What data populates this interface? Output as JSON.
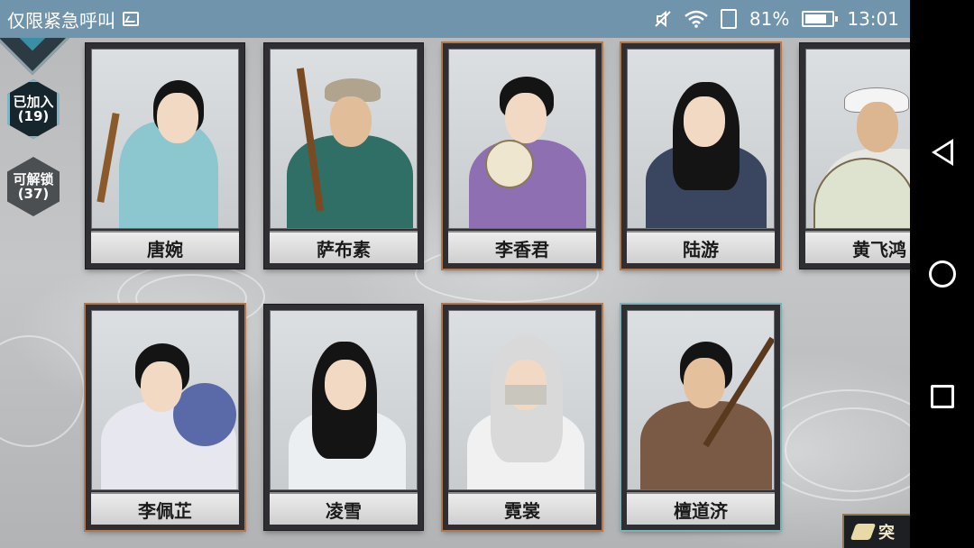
{
  "status_bar": {
    "carrier_text": "仅限紧急呼叫",
    "battery_percent_text": "81%",
    "battery_level": 0.81,
    "time": "13:01",
    "icons": [
      "image-icon",
      "mute-icon",
      "wifi-icon",
      "sim-icon",
      "battery-icon"
    ]
  },
  "side_panel": {
    "joined_label": "已加入",
    "joined_count": "(19)",
    "unlockable_label": "可解锁",
    "unlockable_count": "(37)"
  },
  "characters": [
    {
      "name": "唐婉",
      "frame": "dark"
    },
    {
      "name": "萨布素",
      "frame": "dark"
    },
    {
      "name": "李香君",
      "frame": "orange"
    },
    {
      "name": "陆游",
      "frame": "orange"
    },
    {
      "name": "黄飞鸿",
      "frame": "dark"
    },
    {
      "name": "李佩芷",
      "frame": "orange"
    },
    {
      "name": "凌雪",
      "frame": "dark"
    },
    {
      "name": "霓裳",
      "frame": "orange"
    },
    {
      "name": "檀道济",
      "frame": "teal"
    }
  ],
  "corner_button": {
    "label": "突"
  },
  "colors": {
    "status_bar": "#6f94ab",
    "card_frame": "#2f2f33",
    "orange_frame": "#b4774a",
    "teal_frame": "#7bb0b7"
  }
}
